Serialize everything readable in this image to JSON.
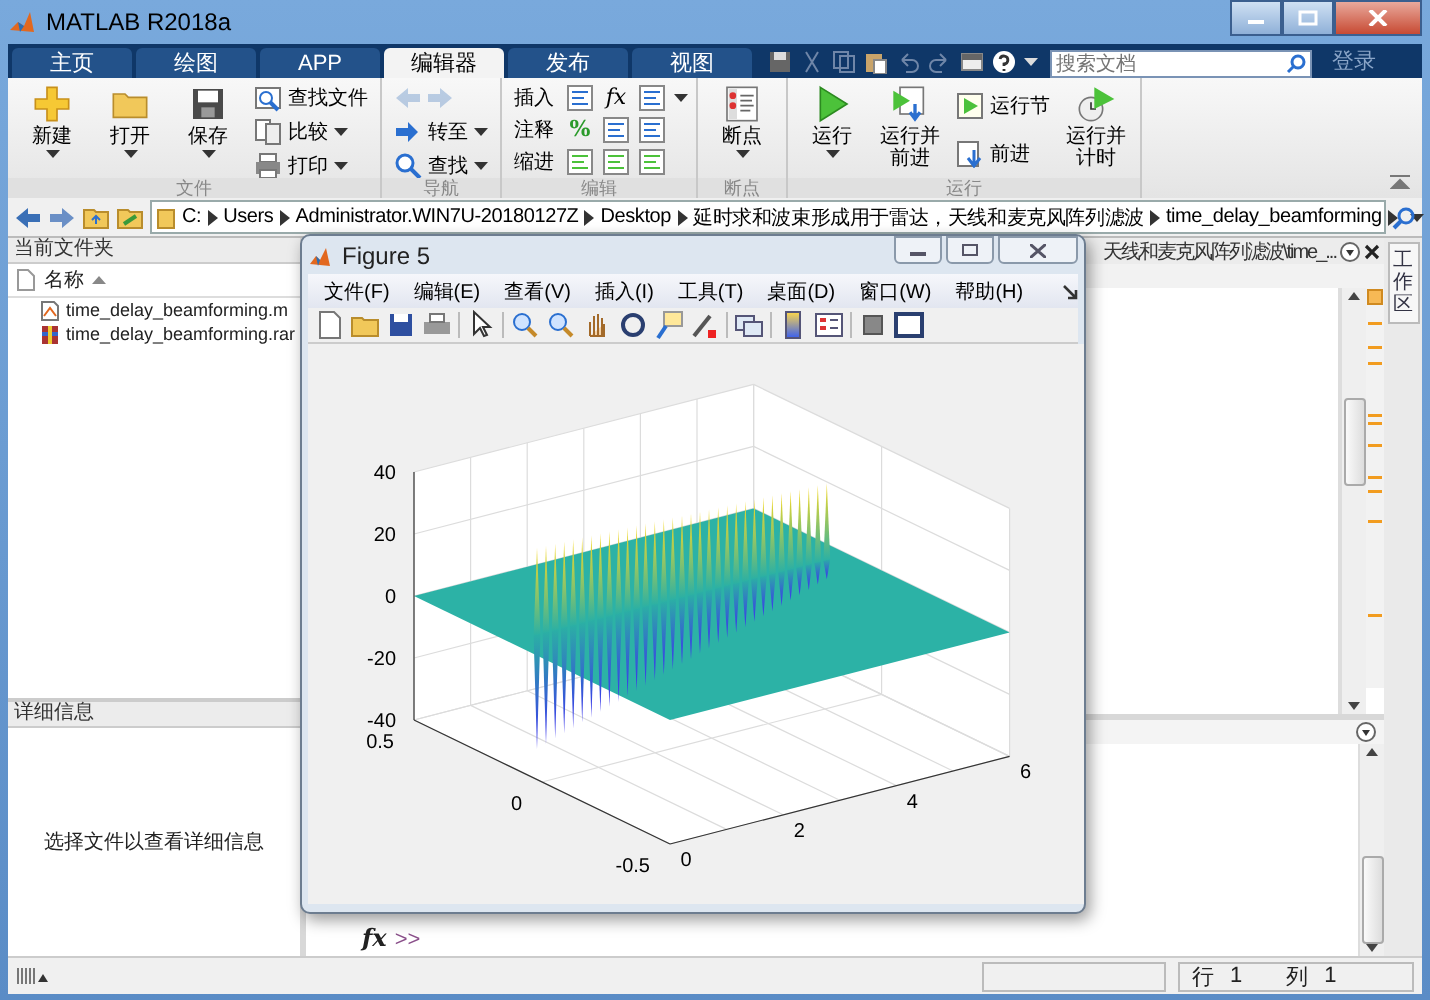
{
  "window": {
    "title": "MATLAB R2018a"
  },
  "tabs": [
    {
      "label": "主页",
      "selected": false
    },
    {
      "label": "绘图",
      "selected": false
    },
    {
      "label": "APP",
      "selected": false
    },
    {
      "label": "编辑器",
      "selected": true
    },
    {
      "label": "发布",
      "selected": false
    },
    {
      "label": "视图",
      "selected": false
    }
  ],
  "search": {
    "placeholder": "搜索文档"
  },
  "login": "登录",
  "ribbon": [
    {
      "title": "文件",
      "items": [
        {
          "kind": "large",
          "label": "新建",
          "dropdown": true
        },
        {
          "kind": "large",
          "label": "打开",
          "dropdown": true
        },
        {
          "kind": "large",
          "label": "保存",
          "dropdown": true
        },
        {
          "kind": "small",
          "label": "查找文件",
          "dropdown": false
        },
        {
          "kind": "small",
          "label": "比较",
          "dropdown": true
        },
        {
          "kind": "small",
          "label": "打印",
          "dropdown": true
        }
      ]
    },
    {
      "title": "导航",
      "items": [
        {
          "kind": "arrows",
          "disabled": true
        },
        {
          "kind": "small",
          "label": "转至",
          "dropdown": true
        },
        {
          "kind": "small",
          "label": "查找",
          "dropdown": true
        }
      ]
    },
    {
      "title": "编辑",
      "items": [
        {
          "kind": "row",
          "label": "插入",
          "glyph": "fx",
          "dropdown": true
        },
        {
          "kind": "row",
          "label": "注释",
          "glyph": "%",
          "dropdown": false
        },
        {
          "kind": "row",
          "label": "缩进",
          "dropdown": false
        }
      ]
    },
    {
      "title": "断点",
      "items": [
        {
          "kind": "large",
          "label": "断点",
          "dropdown": true
        }
      ]
    },
    {
      "title": "运行",
      "items": [
        {
          "kind": "large",
          "label": "运行",
          "dropdown": true
        },
        {
          "kind": "large",
          "label": "运行并前进",
          "dropdown": false
        },
        {
          "kind": "small",
          "label": "运行节",
          "dropdown": false
        },
        {
          "kind": "small",
          "label": "前进",
          "dropdown": false
        },
        {
          "kind": "large",
          "label": "运行并计时",
          "dropdown": false
        }
      ]
    }
  ],
  "path": [
    "C:",
    "Users",
    "Administrator.WIN7U-20180127Z",
    "Desktop",
    "延时求和波束形成用于雷达，天线和麦克风阵列滤波",
    "time_delay_beamforming"
  ],
  "current_folder": {
    "title": "当前文件夹",
    "column": "名称",
    "files": [
      {
        "name": "time_delay_beamforming.m",
        "kind": "script"
      },
      {
        "name": "time_delay_beamforming.rar",
        "kind": "archive"
      }
    ]
  },
  "details": {
    "title": "详细信息",
    "message": "选择文件以查看详细信息"
  },
  "editor": {
    "title": "天线和麦克风阵列滤波\\time_..."
  },
  "command_window": {
    "fx": "fx",
    "prompt": ">>"
  },
  "workspace_tab": "工作区",
  "status_bar": {
    "row_label": "行",
    "row": "1",
    "col_label": "列",
    "col": "1"
  },
  "figure": {
    "title": "Figure 5",
    "menus": [
      "文件(F)",
      "编辑(E)",
      "查看(V)",
      "插入(I)",
      "工具(T)",
      "桌面(D)",
      "窗口(W)",
      "帮助(H)"
    ],
    "z_ticks": [
      "40",
      "20",
      "0",
      "-20",
      "-40"
    ],
    "y_ticks": [
      "0.5",
      "0",
      "-0.5"
    ],
    "x_ticks": [
      "0",
      "2",
      "4",
      "6"
    ]
  }
}
